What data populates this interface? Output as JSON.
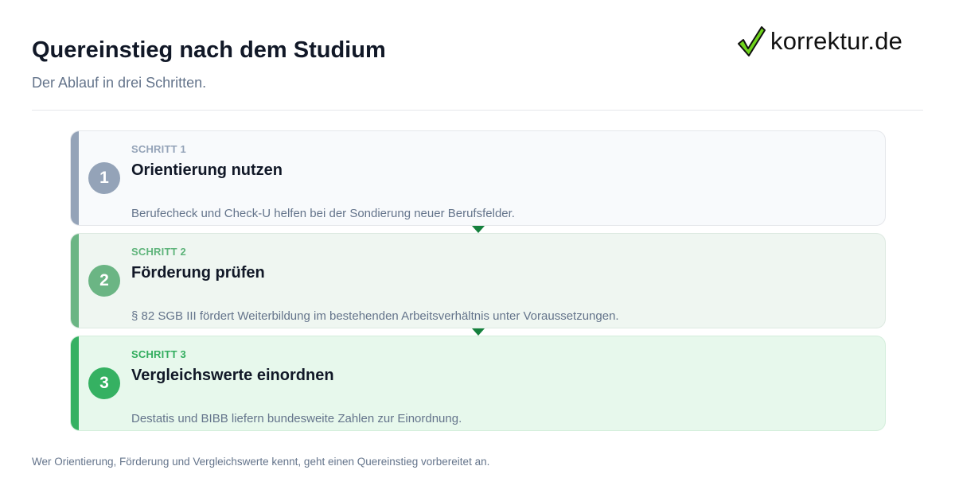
{
  "header": {
    "title": "Quereinstieg nach dem Studium",
    "subtitle": "Der Ablauf in drei Schritten."
  },
  "logo": {
    "text": "korrektur.de",
    "icon": "checkmark-icon",
    "check_color": "#6fd41c"
  },
  "steps": [
    {
      "number": "1",
      "label": "SCHRITT 1",
      "title": "Orientierung nutzen",
      "description": "Berufecheck und Check-U helfen bei der Sondierung neuer Berufsfelder.",
      "accent": "#94a3b8"
    },
    {
      "number": "2",
      "label": "SCHRITT 2",
      "title": "Förderung prüfen",
      "description": "§ 82 SGB III fördert Weiterbildung im bestehenden Arbeitsverhältnis unter Voraussetzungen.",
      "accent": "#6bb584"
    },
    {
      "number": "3",
      "label": "SCHRITT 3",
      "title": "Vergleichswerte einordnen",
      "description": "Destatis und BIBB liefern bundesweite Zahlen zur Einordnung.",
      "accent": "#35b162"
    }
  ],
  "connector": {
    "icon": "arrow-down-icon",
    "color": "#15803d"
  },
  "footer": {
    "text": "Wer Orientierung, Förderung und Vergleichswerte kennt, geht einen Quereinstieg vorbereitet an."
  }
}
